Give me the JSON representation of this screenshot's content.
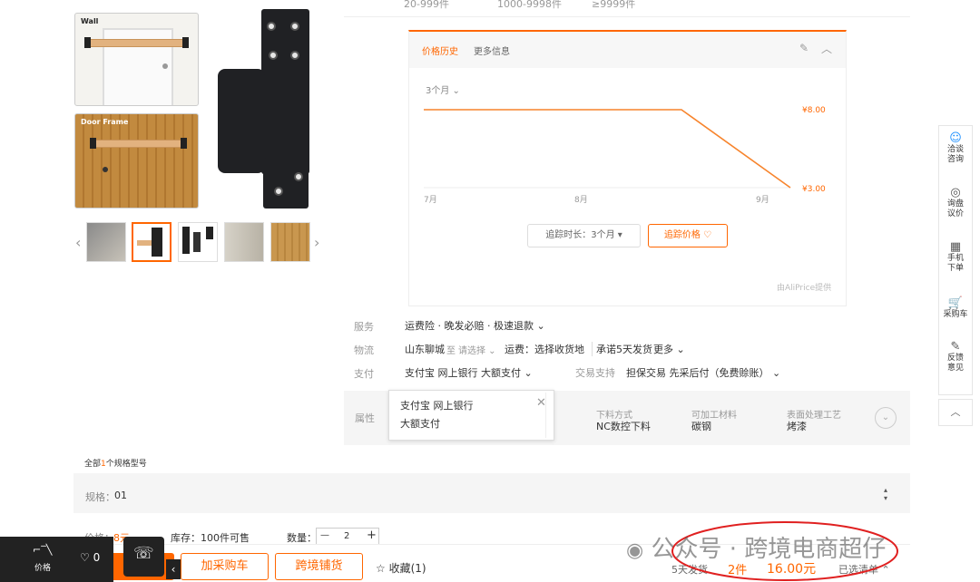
{
  "top_row": [
    "20-999件",
    "1000-9998件",
    "≥9999件"
  ],
  "gallery": {
    "tag1": "Wall",
    "tag2": "Door Frame",
    "prev_arrow": "‹",
    "next_arrow": "›"
  },
  "price_history": {
    "tab_active": "价格历史",
    "tab_more": "更多信息",
    "period": "3个月",
    "price_high": "¥8.00",
    "price_low": "¥3.00",
    "x_labels": [
      "7月",
      "8月",
      "9月"
    ],
    "track_duration": "追踪时长：3个月",
    "track_price": "追踪价格 ♡",
    "footer": "由AliPrice提供",
    "chart_data": {
      "type": "line",
      "x": [
        "7月",
        "8月",
        "9月"
      ],
      "series": [
        {
          "values": [
            8.0,
            8.0,
            3.0
          ]
        }
      ],
      "annotations": [
        "¥8.00",
        "¥3.00"
      ]
    }
  },
  "service": {
    "label": "服务",
    "value": "运费险 · 晚发必赔 · 极速退款"
  },
  "logistics": {
    "label": "物流",
    "origin": "山东聊城",
    "to": "至",
    "select": "请选择",
    "freight": "运费：选择收货地",
    "promise": "承诺5天发货",
    "more": "更多"
  },
  "payment": {
    "label": "支付",
    "value": "支付宝  网上银行  大额支付",
    "trade_label": "交易支持",
    "trade_value": "担保交易  先采后付（免费赊账）"
  },
  "attributes": {
    "label": "属性",
    "popup_line1": "支付宝  网上银行",
    "popup_line2": "大额支付",
    "items": [
      {
        "k": "下料方式",
        "v": "NC数控下料"
      },
      {
        "k": "可加工材料",
        "v": "碳钢"
      },
      {
        "k": "表面处理工艺",
        "v": "烤漆"
      }
    ]
  },
  "spec_summary": {
    "prefix": "全部",
    "count": "1",
    "suffix": "个规格型号"
  },
  "spec": {
    "label": "规格：",
    "value": "01"
  },
  "order": {
    "price_label": "价格：",
    "price": "8元",
    "stock": "库存：100件可售",
    "qty_label": "数量：",
    "qty": "2",
    "minus": "—",
    "plus": "+"
  },
  "bottom_bar": {
    "add_cart": "加采购车",
    "cross_border": "跨境铺货",
    "favorite": "☆ 收藏(1)",
    "ship": "5天发货",
    "count": "2件",
    "total": "16.00元",
    "selected": "已选清单"
  },
  "float_left": {
    "price_label": "价格",
    "likes": "♡ 0"
  },
  "sidebar": [
    {
      "icon": "☺",
      "label": "洽谈\n咨询"
    },
    {
      "icon": "◎",
      "label": "询盘\n议价"
    },
    {
      "icon": "▦",
      "label": "手机\n下单"
    },
    {
      "icon": "🛒",
      "label": "采购车"
    },
    {
      "icon": "✎",
      "label": "反馈\n意见"
    }
  ],
  "watermark": "公众号 · 跨境电商超仔"
}
